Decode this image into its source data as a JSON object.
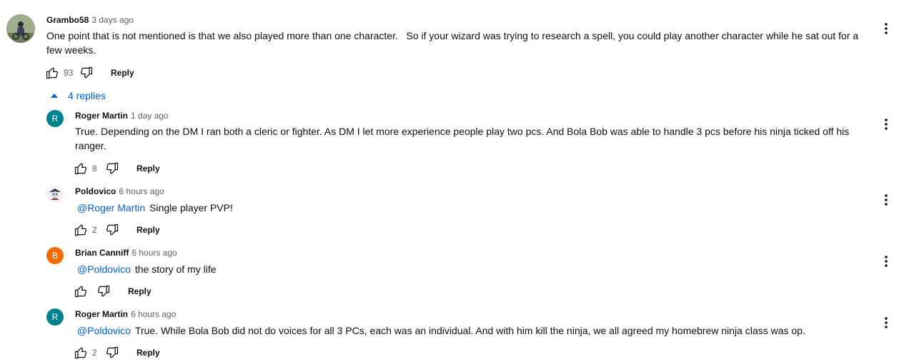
{
  "top_comment": {
    "author": "Grambo58",
    "time": "3 days ago",
    "text_line1": "One point that is not mentioned is that we also played more than one character.   So if your wizard was trying to research a spell, you could play another character while he sat out for a",
    "text_line2": "few weeks.",
    "likes": "93",
    "reply_label": "Reply"
  },
  "replies_toggle": {
    "label": "4 replies"
  },
  "replies": [
    {
      "author": "Roger Martin",
      "time": "1 day ago",
      "avatar_letter": "R",
      "avatar_color": "#00838f",
      "text_line1": "True. Depending on the DM I ran both a cleric or fighter. As DM I let more experience people play two pcs. And Bola Bob was able to handle 3 pcs before his ninja ticked off his",
      "text_line2": "ranger.",
      "likes": "8",
      "reply_label": "Reply"
    },
    {
      "author": "Poldovico",
      "time": "6 hours ago",
      "mention": "@Roger Martin",
      "text": "Single player PVP!",
      "likes": "2",
      "reply_label": "Reply"
    },
    {
      "author": "Brian Canniff",
      "time": "6 hours ago",
      "avatar_letter": "B",
      "avatar_color": "#ef6c00",
      "mention": "@Poldovico",
      "text": "the story of my life",
      "likes": "",
      "reply_label": "Reply"
    },
    {
      "author": "Roger Martin",
      "time": "6 hours ago",
      "avatar_letter": "R",
      "avatar_color": "#00838f",
      "mention": "@Poldovico",
      "text": "True. While Bola Bob did not do voices for all 3 PCs, each was an individual. And with him kill the ninja, we all agreed my homebrew ninja class was op.",
      "likes": "2",
      "reply_label": "Reply"
    }
  ],
  "colors": {
    "link": "#065fd4",
    "muted": "#606060",
    "text": "#0f0f0f"
  },
  "icons": [
    "like-icon",
    "dislike-icon",
    "more-options-icon",
    "chevron-up-icon"
  ]
}
